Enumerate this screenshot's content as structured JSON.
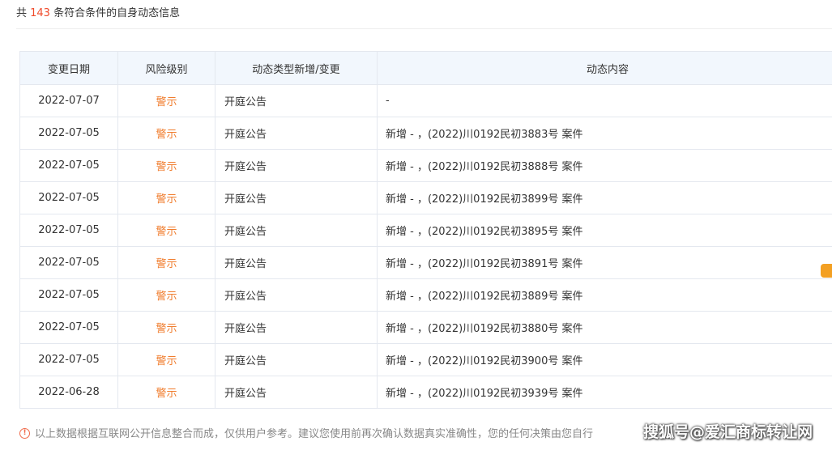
{
  "summary": {
    "prefix": "共 ",
    "count": "143",
    "suffix": " 条符合条件的自身动态信息"
  },
  "table": {
    "headers": [
      "变更日期",
      "风险级别",
      "动态类型新增/变更",
      "动态内容"
    ],
    "rows": [
      {
        "date": "2022-07-07",
        "risk": "警示",
        "type": "开庭公告",
        "content": "-"
      },
      {
        "date": "2022-07-05",
        "risk": "警示",
        "type": "开庭公告",
        "content": "新增 - ，(2022)川0192民初3883号 案件"
      },
      {
        "date": "2022-07-05",
        "risk": "警示",
        "type": "开庭公告",
        "content": "新增 - ，(2022)川0192民初3888号 案件"
      },
      {
        "date": "2022-07-05",
        "risk": "警示",
        "type": "开庭公告",
        "content": "新增 - ，(2022)川0192民初3899号 案件"
      },
      {
        "date": "2022-07-05",
        "risk": "警示",
        "type": "开庭公告",
        "content": "新增 - ，(2022)川0192民初3895号 案件"
      },
      {
        "date": "2022-07-05",
        "risk": "警示",
        "type": "开庭公告",
        "content": "新增 - ，(2022)川0192民初3891号 案件"
      },
      {
        "date": "2022-07-05",
        "risk": "警示",
        "type": "开庭公告",
        "content": "新增 - ，(2022)川0192民初3889号 案件"
      },
      {
        "date": "2022-07-05",
        "risk": "警示",
        "type": "开庭公告",
        "content": "新增 - ，(2022)川0192民初3880号 案件"
      },
      {
        "date": "2022-07-05",
        "risk": "警示",
        "type": "开庭公告",
        "content": "新增 - ，(2022)川0192民初3900号 案件"
      },
      {
        "date": "2022-06-28",
        "risk": "警示",
        "type": "开庭公告",
        "content": "新增 - ，(2022)川0192民初3939号 案件"
      }
    ]
  },
  "disclaimer": {
    "icon": "warning-circle-icon",
    "text": "以上数据根据互联网公开信息整合而成，仅供用户参考。建议您使用前再次确认数据真实准确性，您的任何决策由您自行"
  },
  "watermark": "搜狐号@爱汇商标转让网",
  "colors": {
    "count": "#f04a2a",
    "risk": "#f07d2e",
    "header_bg": "#f2f7fd",
    "border": "#e4e8ef",
    "side_tag": "#f3a023"
  }
}
